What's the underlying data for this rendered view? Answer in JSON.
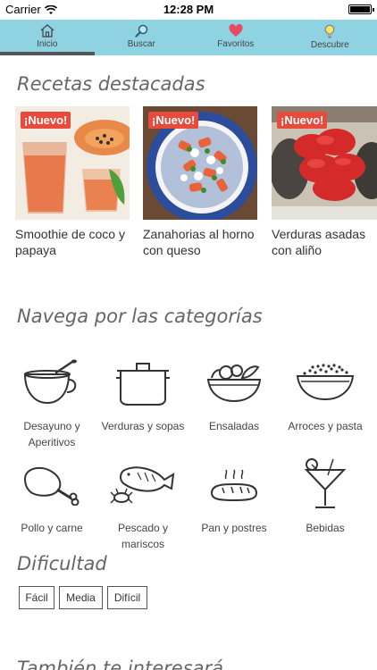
{
  "status_bar": {
    "carrier": "Carrier",
    "time": "12:28 PM"
  },
  "tabs": [
    {
      "label": "Inicio",
      "icon": "home-icon"
    },
    {
      "label": "Buscar",
      "icon": "search-icon"
    },
    {
      "label": "Favoritos",
      "icon": "heart-icon"
    },
    {
      "label": "Descubre",
      "icon": "lightbulb-icon"
    }
  ],
  "colors": {
    "tab_bar": "#8fd3e3",
    "badge": "#e84a3c",
    "heart": "#e84a5f"
  },
  "featured": {
    "title": "Recetas destacadas",
    "items": [
      {
        "badge": "¡Nuevo!",
        "title": "Smoothie de coco y papaya"
      },
      {
        "badge": "¡Nuevo!",
        "title": "Zanahorias al horno con queso"
      },
      {
        "badge": "¡Nuevo!",
        "title": "Verduras asadas con aliño"
      }
    ]
  },
  "categories": {
    "title": "Navega por las categorías",
    "items": [
      {
        "label": "Desayuno y Aperitivos",
        "icon": "cup-icon"
      },
      {
        "label": "Verduras y sopas",
        "icon": "pot-icon"
      },
      {
        "label": "Ensaladas",
        "icon": "salad-bowl-icon"
      },
      {
        "label": "Arroces y pasta",
        "icon": "rice-bowl-icon"
      },
      {
        "label": "Pollo y carne",
        "icon": "chicken-leg-icon"
      },
      {
        "label": "Pescado y mariscos",
        "icon": "fish-icon"
      },
      {
        "label": "Pan y postres",
        "icon": "bread-icon"
      },
      {
        "label": "Bebidas",
        "icon": "cocktail-icon"
      }
    ]
  },
  "difficulty": {
    "title": "Dificultad",
    "options": [
      "Fácil",
      "Media",
      "Difícil"
    ]
  },
  "more": {
    "title": "También te interesará"
  }
}
